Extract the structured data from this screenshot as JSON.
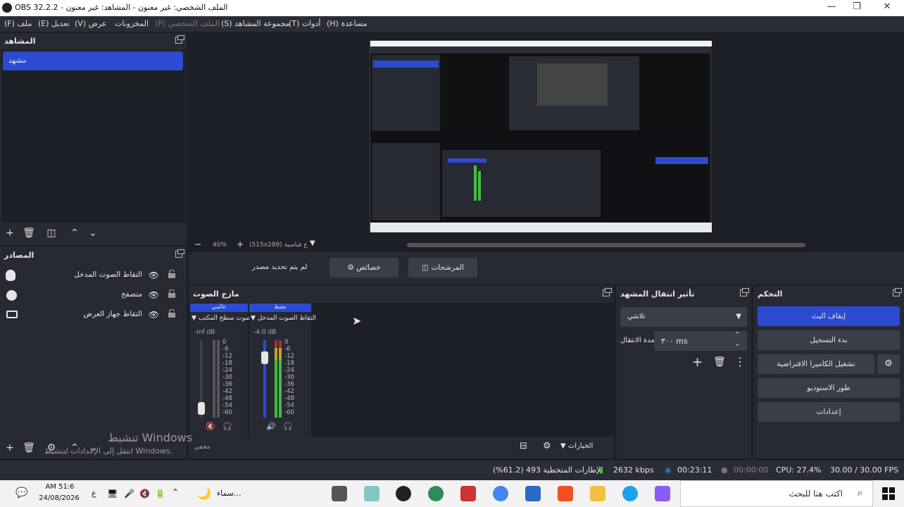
{
  "window": {
    "title": "الملف الشخصي: غير معنون - المشاهد: غير معنون - OBS 32.2.2",
    "min_icon": "minimize-icon",
    "max_icon": "restore-icon",
    "close_icon": "close-icon"
  },
  "menu": {
    "file": "(F) ملف",
    "edit": "(E) تعديل",
    "view": "(V) عرض",
    "stored": "المخزونات",
    "profile": "(P) الملف الشخصي",
    "scene_collection": "(S) مجموعة المشاهد",
    "tools": "(T) أدوات",
    "help": "(H) مساعدة"
  },
  "scenes": {
    "title": "المشاهد",
    "items": [
      "مشهد"
    ]
  },
  "sources": {
    "title": "المصادر",
    "items": [
      {
        "label": "التقاط الصوت المدخل",
        "icon": "microphone-icon"
      },
      {
        "label": "متصفح",
        "icon": "globe-icon"
      },
      {
        "label": "التقاط جهاز العرض",
        "icon": "monitor-icon"
      }
    ]
  },
  "preview": {
    "zoom": "40%",
    "scale_label": "(515x289) ع قياسية"
  },
  "context": {
    "no_source": "لم يتم تحديد مصدر",
    "properties": "خصائص",
    "filters": "المرشحات"
  },
  "mixer": {
    "title": "مازج الصوت",
    "channels": [
      {
        "tag": "عالمي",
        "name": "صوت سطح المكتب",
        "db": "-inf dB"
      },
      {
        "tag": "نشط",
        "name": "التقاط الصوت المدخل",
        "db": "-4.0 dB"
      }
    ],
    "ticks": [
      "0",
      "-6",
      "-12",
      "-18",
      "-24",
      "-30",
      "-36",
      "-42",
      "-48",
      "-54",
      "-60"
    ],
    "options": "الخيارات",
    "watermark1": "تنشيط Windows",
    "watermark2": "انتقل إلى الإعدادات لتنشيط Windows.",
    "muted_label": "مخفي"
  },
  "transitions": {
    "title": "تأثير انتقال المشهد",
    "selected": "تلاشي",
    "duration_label": "مدة الانتقال",
    "duration_value": "٣٠٠ ms"
  },
  "controls": {
    "title": "التحكم",
    "stop_stream": "إيقاف البث",
    "start_record": "بدء التسجيل",
    "virtual_cam": "تشغيل الكاميرا الافتراضية",
    "studio_mode": "طور الاستوديو",
    "settings": "إعدادات"
  },
  "status": {
    "dropped": "الإطارات المتخطية 493 (61.2%)",
    "kbps": "2632 kbps",
    "stream_time": "00:23:11",
    "rec_time": "00:00:00",
    "cpu": "CPU: 27.4%",
    "fps": "30.00 / 30.00 FPS"
  },
  "taskbar": {
    "time": "AM 51:6",
    "date": "24/08/2026",
    "lang": "ع",
    "weather": "سماء...",
    "search": "اكتب هنا للبحث"
  },
  "colors": {
    "accent": "#2c4bd1",
    "panel": "#272a33",
    "bg": "#1d1f26",
    "meter_green": "#3fbf3f"
  }
}
